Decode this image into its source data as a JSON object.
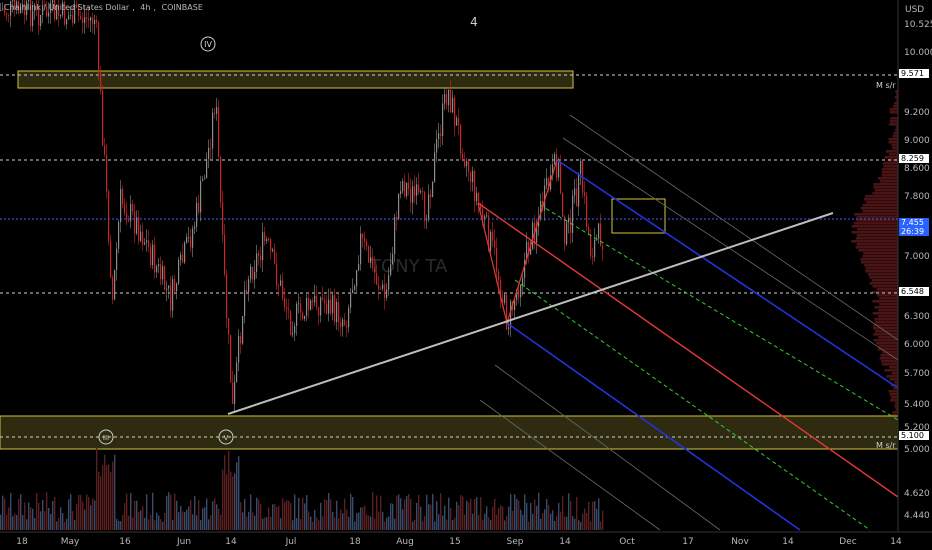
{
  "header": {
    "symbol": "Chainlink / United States Dollar",
    "interval": "4h",
    "exchange": "COINBASE",
    "center_label": "4",
    "currency": "USD"
  },
  "wave_labels": [
    "IV",
    "III",
    "V"
  ],
  "zone_labels": {
    "upper": "M s/r",
    "lower": "M s/r"
  },
  "watermark": "TONY TA",
  "price_tags": [
    {
      "value": "9.571",
      "bg": "#ffffff",
      "fg": "#000000"
    },
    {
      "value": "8.259",
      "bg": "#ffffff",
      "fg": "#000000"
    },
    {
      "value": "7.455",
      "sub": "26:39",
      "bg": "#2962ff",
      "fg": "#ffffff"
    },
    {
      "value": "6.548",
      "bg": "#ffffff",
      "fg": "#000000"
    },
    {
      "value": "5.100",
      "bg": "#ffffff",
      "fg": "#000000"
    }
  ],
  "y_axis_ticks": [
    "10.525",
    "10.000",
    "9.200",
    "9.000",
    "8.600",
    "7.800",
    "7.000",
    "6.300",
    "6.000",
    "5.700",
    "5.400",
    "5.200",
    "5.000",
    "4.620",
    "4.440"
  ],
  "x_axis_ticks": [
    "18",
    "May",
    "16",
    "Jun",
    "14",
    "Jul",
    "18",
    "Aug",
    "15",
    "Sep",
    "14",
    "Oct",
    "17",
    "Nov",
    "14",
    "Dec",
    "14"
  ],
  "colors": {
    "background": "#000000",
    "candle_up": "#8c8c8c",
    "candle_down": "#c62828",
    "zone_fill": "#2e2b10",
    "zone_border": "#d6c33b",
    "pitchfork_median": "#e53935",
    "pitchfork_outer": "#2233dd",
    "pitchfork_inner": "#33cc33",
    "trendline": "#bdbdbd"
  }
}
